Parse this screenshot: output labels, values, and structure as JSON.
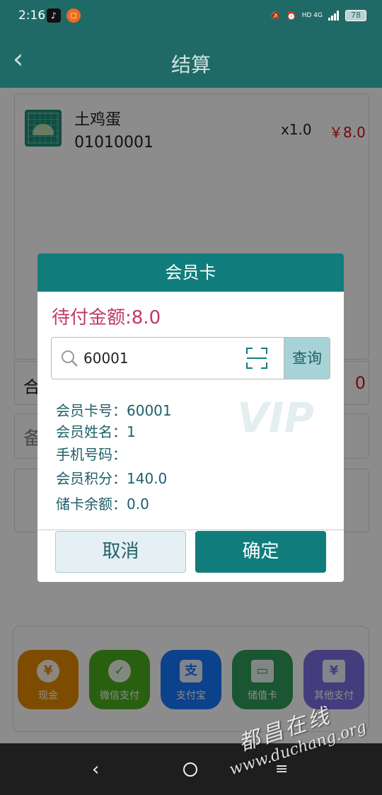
{
  "status_bar": {
    "time": "2:16",
    "network": "4G",
    "hd": "HD",
    "battery": "78"
  },
  "app_bar": {
    "title": "结算"
  },
  "order": {
    "item": {
      "name": "土鸡蛋",
      "code": "01010001",
      "qty": "x1.0",
      "price": "￥8.0"
    },
    "total_label": "合",
    "total_value": "0",
    "remark_label": "备"
  },
  "payment_methods": [
    {
      "label": "现金",
      "icon": "yuan-icon",
      "color": "#e68a00"
    },
    {
      "label": "微信支付",
      "icon": "wechat-icon",
      "color": "#4caf1e"
    },
    {
      "label": "支付宝",
      "icon": "alipay-icon",
      "color": "#1677ff"
    },
    {
      "label": "储值卡",
      "icon": "card-icon",
      "color": "#2e9d5a"
    },
    {
      "label": "其他支付",
      "icon": "ticket-icon",
      "color": "#7b6fe6"
    }
  ],
  "dialog": {
    "title": "会员卡",
    "amount_due": "待付金额:8.0",
    "search": {
      "value": "60001",
      "query_label": "查询"
    },
    "vip_mark": "VIP",
    "info": {
      "card_no": "会员卡号：60001",
      "name": "会员姓名：1",
      "phone": "手机号码：",
      "points": "会员积分：140.0",
      "balance": "储卡余额：0.0"
    },
    "cancel_label": "取消",
    "confirm_label": "确定"
  },
  "watermark": {
    "cn": "都昌在线",
    "url": "www.duchang.org"
  },
  "colors": {
    "primary": "#107d7c",
    "appbar": "#1f6a66",
    "accent": "#c0386c",
    "price": "#e01010"
  }
}
